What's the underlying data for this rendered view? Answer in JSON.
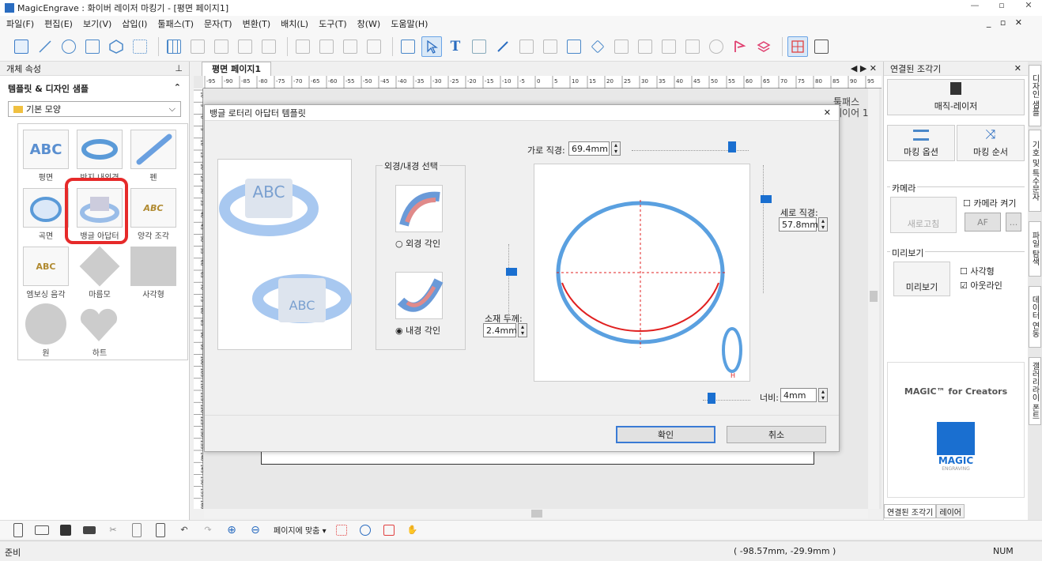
{
  "window": {
    "title": "MagicEngrave : 화이버 레이저 마킹기 - [평면 페이지1]",
    "controls": [
      "—",
      "▫",
      "✕"
    ],
    "mdi_controls": "_ ▫ ✕"
  },
  "menu": [
    "파일(F)",
    "편집(E)",
    "보기(V)",
    "삽입(I)",
    "툴패스(T)",
    "문자(T)",
    "변환(T)",
    "배치(L)",
    "도구(T)",
    "창(W)",
    "도움말(H)"
  ],
  "left_panel": {
    "header": "개체 속성",
    "pin": "⊥",
    "section_title": "템플릿 & 디자인 샘플",
    "collapse": "⌃",
    "combo_value": "기본 모양",
    "tiles": [
      "평면",
      "반지 내외경",
      "펜",
      "곡면",
      "뱅글 아답터",
      "양각 조각",
      "엠보싱 음각",
      "마름모",
      "사각형",
      "원",
      "하트"
    ]
  },
  "doc_tab": {
    "label": "평면  페이지1",
    "nav": "◀ ▶ ✕"
  },
  "ruler_ticks": [
    "-95",
    "-90",
    "-85",
    "-80",
    "-75",
    "-70",
    "-65",
    "-60",
    "-55",
    "-50",
    "-45",
    "-40",
    "-35",
    "-30",
    "-25",
    "-20",
    "-15",
    "-10",
    "-5",
    "0",
    "5",
    "10",
    "15",
    "20",
    "25",
    "30",
    "35",
    "40",
    "45",
    "50",
    "55",
    "60",
    "65",
    "70",
    "75",
    "80",
    "85",
    "90",
    "95"
  ],
  "ruler_v_ticks": [
    "10",
    "5",
    "0",
    "5",
    "10",
    "15",
    "20",
    "25",
    "30",
    "35",
    "40",
    "45",
    "50",
    "55",
    "60",
    "65",
    "70",
    "75",
    "80",
    "85",
    "90",
    "95",
    "100",
    "105",
    "110",
    "115",
    "120",
    "125",
    "130",
    "135",
    "140",
    "145",
    "150",
    "155",
    "160"
  ],
  "background_label": {
    "line1": "툴패스",
    "line2": "레이어 1"
  },
  "dialog": {
    "title": "뱅글 로터리 아답터 템플릿",
    "close": "✕",
    "group_title": "외경/내경 선택",
    "outer_label": "외경 각인",
    "inner_label": "내경 각인",
    "h_diam_label": "가로 직경:",
    "h_diam_value": "69.4mm",
    "v_diam_label": "세로 직경:",
    "v_diam_value": "57.8mm",
    "thick_label": "소재 두께:",
    "thick_value": "2.4mm",
    "width_label": "너비:",
    "width_value": "4mm",
    "ok": "확인",
    "cancel": "취소",
    "preview_text": "ABC",
    "h_marker": "H"
  },
  "right_panel": {
    "header": "연결된 조각기",
    "close": "✕",
    "device": "매직-레이저",
    "mark_options": "마킹 옵션",
    "mark_order": "마킹 순서",
    "camera_group": "카메라",
    "camera_on": "카메라 켜기",
    "refresh": "새로고침",
    "af": "AF",
    "more": "...",
    "preview_group": "미리보기",
    "preview_btn": "미리보기",
    "rect": "사각형",
    "outline": "아웃라인",
    "logo_title": "MAGIC™ for Creators",
    "logo_text": "MAGIC",
    "logo_sub": "ENGRAVING",
    "bottom_tabs": [
      "연결된 조각기",
      "레이어"
    ]
  },
  "side_tabs": [
    "디자인 샘플",
    "기호 및 특수문자",
    "파일 탐색",
    "데이터 연동",
    "갤러리라이 폰트"
  ],
  "bottom_toolbar": {
    "fit_page": "페이지에 맞춤"
  },
  "status": {
    "left": "준비",
    "coords": "( -98.57mm, -29.9mm )",
    "num": "NUM"
  },
  "colors": {
    "accent": "#2a6cc0",
    "highlight": "#e62a2a",
    "ellipse": "#5aa0e0",
    "inner_arc": "#e02020"
  }
}
